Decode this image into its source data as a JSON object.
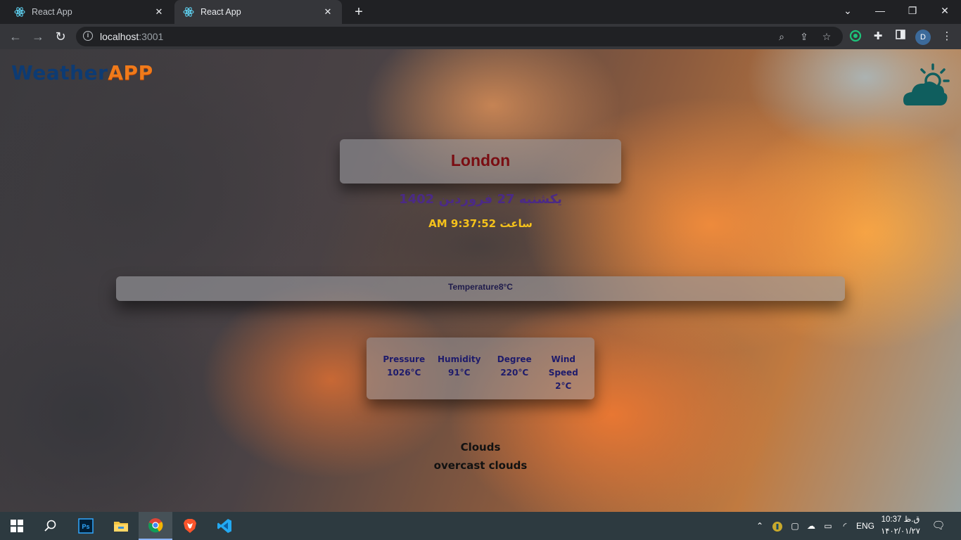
{
  "browser": {
    "tabs": [
      {
        "title": "React App",
        "active": false
      },
      {
        "title": "React App",
        "active": true
      }
    ],
    "new_tab": "+",
    "url_host": "localhost",
    "url_port": ":3001",
    "profile_initial": "D"
  },
  "app": {
    "logo_part1": "Weather",
    "logo_part2": "APP",
    "city": "London",
    "date": "یکشنبه 27 فروردین 1402",
    "time": "ساعت 9:37:52 AM",
    "temperature": "Temperature8°C",
    "stats": [
      {
        "label": "Pressure",
        "value": "1026°C"
      },
      {
        "label": "Humidity",
        "value": "91°C"
      },
      {
        "label": "Degree",
        "value": "220°C"
      },
      {
        "label": "Wind Speed",
        "value": "2°C"
      }
    ],
    "condition": "Clouds",
    "description": "overcast clouds"
  },
  "taskbar": {
    "language": "ENG",
    "time": "10:37 ق.ظ",
    "date": "۱۴۰۲/۰۱/۲۷"
  },
  "colors": {
    "city": "#7a0d12",
    "date": "#4b2a86",
    "time": "#f5c21b",
    "logo_primary": "#0d3b73",
    "logo_accent": "#f07a1a"
  }
}
